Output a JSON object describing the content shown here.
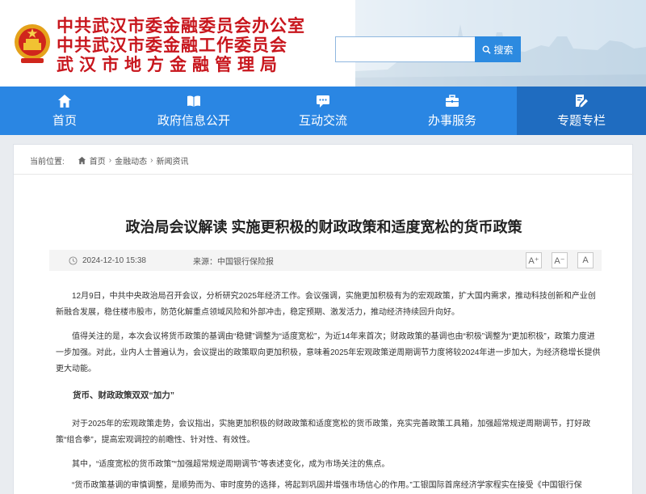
{
  "header": {
    "org_line1": "中共武汉市委金融委员会办公室",
    "org_line2": "中共武汉市委金融工作委员会",
    "org_line3": "武汉市地方金融管理局",
    "search_placeholder": "",
    "search_button": "搜索",
    "brand_color": "#c8161d"
  },
  "nav": {
    "items": [
      {
        "label": "首页",
        "icon": "home-icon"
      },
      {
        "label": "政府信息公开",
        "icon": "open-book-icon"
      },
      {
        "label": "互动交流",
        "icon": "chat-bubble-icon"
      },
      {
        "label": "办事服务",
        "icon": "briefcase-icon"
      },
      {
        "label": "专题专栏",
        "icon": "edit-note-icon"
      }
    ],
    "active_index": 4,
    "bg_color": "#2a86e3",
    "active_color": "#1f6cc0"
  },
  "breadcrumb": {
    "prefix": "当前位置:",
    "items": [
      "首页",
      "金融动态",
      "新闻资讯"
    ],
    "separator": "›"
  },
  "article": {
    "title": "政治局会议解读 实施更积极的财政政策和适度宽松的货币政策",
    "date": "2024-12-10 15:38",
    "source": "来源：中国银行保险报",
    "font_buttons": [
      "A⁺",
      "A⁻",
      "A"
    ],
    "paragraphs": [
      "12月9日，中共中央政治局召开会议，分析研究2025年经济工作。会议强调，实施更加积极有为的宏观政策，扩大国内需求，推动科技创新和产业创新融合发展，稳住楼市股市，防范化解重点领域风险和外部冲击，稳定预期、激发活力，推动经济持续回升向好。",
      "值得关注的是，本次会议将货币政策的基调由“稳健”调整为“适度宽松”，为近14年来首次；财政政策的基调也由“积极”调整为“更加积极”，政策力度进一步加强。对此，业内人士普遍认为，会议提出的政策取向更加积极，意味着2025年宏观政策逆周期调节力度将较2024年进一步加大，为经济稳增长提供更大动能。",
      "货币、财政政策双双“加力”",
      "对于2025年的宏观政策走势，会议指出，实施更加积极的财政政策和适度宽松的货币政策，充实完善政策工具箱，加强超常规逆周期调节，打好政策“组合拳”，提高宏观调控的前瞻性、针对性、有效性。",
      "其中，“适度宽松的货币政策”“加强超常规逆周期调节”等表述变化，成为市场关注的焦点。",
      "“货币政策基调的审慎调整，是顺势而为、审时度势的选择，将起到巩固并增强市场信心的作用。”工银国际首席经济学家程实在接受《中国银行保"
    ]
  }
}
